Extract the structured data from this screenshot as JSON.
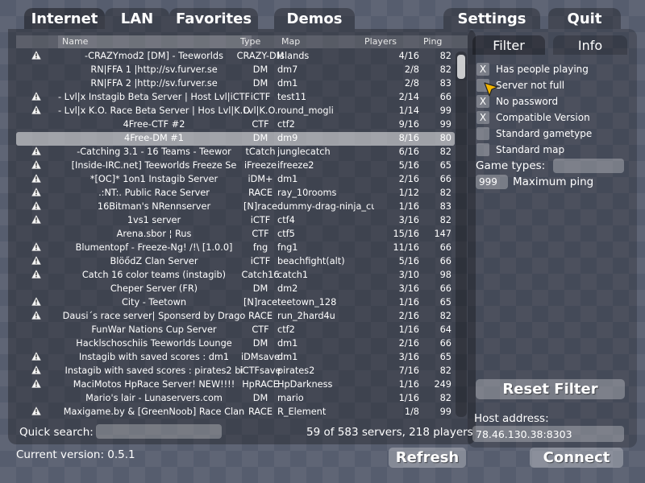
{
  "tabs": {
    "internet": "Internet",
    "lan": "LAN",
    "favorites": "Favorites",
    "demos": "Demos",
    "settings": "Settings",
    "quit": "Quit"
  },
  "header": {
    "name": "Name",
    "type": "Type",
    "map": "Map",
    "players": "Players",
    "ping": "Ping"
  },
  "servers": [
    {
      "icon": "warning-icon",
      "name": "-CRAZYmod2 [DM] - Teeworlds",
      "type": "CRAZY-DM",
      "map": "islands",
      "players": "4/16",
      "ping": "82"
    },
    {
      "icon": "",
      "name": "RN|FFA 1 |http://sv.furver.se",
      "type": "DM",
      "map": "dm7",
      "players": "2/8",
      "ping": "82"
    },
    {
      "icon": "",
      "name": "RN|FFA 2 |http://sv.furver.se",
      "type": "DM",
      "map": "dm1",
      "players": "2/8",
      "ping": "83"
    },
    {
      "icon": "warning-icon",
      "name": "- Lvl|x Instagib Beta Server | Host Lvl|iCTF",
      "type": "iCTF",
      "map": "test11",
      "players": "2/14",
      "ping": "66"
    },
    {
      "icon": "warning-icon",
      "name": "- Lvl|x K.O. Race Beta Server | Hos Lvl|K.O.",
      "type": "Lvl|K.O.",
      "map": "round_mogli",
      "players": "1/14",
      "ping": "99"
    },
    {
      "icon": "",
      "name": "4Free-CTF #2",
      "type": "CTF",
      "map": "ctf2",
      "players": "9/16",
      "ping": "99"
    },
    {
      "icon": "",
      "name": "4Free-DM #1",
      "type": "DM",
      "map": "dm9",
      "players": "8/16",
      "ping": "80",
      "selected": true
    },
    {
      "icon": "warning-icon",
      "name": "-Catching 3.1 - 16 Teams - Teewor",
      "type": "tCatch",
      "map": "junglecatch",
      "players": "6/16",
      "ping": "82"
    },
    {
      "icon": "warning-icon",
      "name": "[Inside-IRC.net] Teeworlds Freeze Se",
      "type": "iFreeze",
      "map": "ifreeze2",
      "players": "5/16",
      "ping": "65"
    },
    {
      "icon": "warning-icon",
      "name": "*[OC]* 1on1 Instagib Server",
      "type": "iDM+",
      "map": "dm1",
      "players": "2/16",
      "ping": "66"
    },
    {
      "icon": "warning-icon",
      "name": ".:NT:. Public Race Server",
      "type": "RACE",
      "map": "ray_10rooms",
      "players": "1/12",
      "ping": "82"
    },
    {
      "icon": "warning-icon",
      "name": "16Bitman's NRennserver",
      "type": "[N]race",
      "map": "dummy-drag-ninja_custom",
      "players": "1/16",
      "ping": "83"
    },
    {
      "icon": "warning-icon",
      "name": "1vs1 server",
      "type": "iCTF",
      "map": "ctf4",
      "players": "3/16",
      "ping": "82"
    },
    {
      "icon": "",
      "name": "Arena.sbor ¦ Rus",
      "type": "CTF",
      "map": "ctf5",
      "players": "15/16",
      "ping": "147"
    },
    {
      "icon": "warning-icon",
      "name": "Blumentopf - Freeze-Ng! /!\\ [1.0.0]",
      "type": "fng",
      "map": "fng1",
      "players": "11/16",
      "ping": "66"
    },
    {
      "icon": "warning-icon",
      "name": "BlöődZ Clan Server",
      "type": "iCTF",
      "map": "beachfight(alt)",
      "players": "5/16",
      "ping": "66"
    },
    {
      "icon": "warning-icon",
      "name": "Catch 16 color teams (instagib)",
      "type": "Catch16",
      "map": "catch1",
      "players": "3/10",
      "ping": "98"
    },
    {
      "icon": "",
      "name": "Cheper Server (FR)",
      "type": "DM",
      "map": "dm2",
      "players": "3/16",
      "ping": "66"
    },
    {
      "icon": "warning-icon",
      "name": "City - Teetown",
      "type": "[N]race",
      "map": "teetown_128",
      "players": "1/16",
      "ping": "65"
    },
    {
      "icon": "warning-icon",
      "name": "Dausi´s race server| Sponserd by Drago",
      "type": "RACE",
      "map": "run_2hard4u",
      "players": "2/16",
      "ping": "82"
    },
    {
      "icon": "",
      "name": "FunWar Nations Cup Server",
      "type": "CTF",
      "map": "ctf2",
      "players": "1/16",
      "ping": "64"
    },
    {
      "icon": "",
      "name": "Hacklschoschiis Teeworlds Lounge",
      "type": "DM",
      "map": "dm1",
      "players": "2/16",
      "ping": "66"
    },
    {
      "icon": "warning-icon",
      "name": "Instagib with saved scores : dm1",
      "type": "iDMsave",
      "map": "dm1",
      "players": "3/16",
      "ping": "65"
    },
    {
      "icon": "warning-icon",
      "name": "Instagib with saved scores : pirates2 bi",
      "type": "iCTFsave",
      "map": "pirates2",
      "players": "7/16",
      "ping": "82"
    },
    {
      "icon": "warning-icon",
      "name": "MaciMotos HpRace Server! NEW!!!!",
      "type": "HpRACE",
      "map": "HpDarkness",
      "players": "1/16",
      "ping": "249"
    },
    {
      "icon": "",
      "name": "Mario's lair - Lunaservers.com",
      "type": "DM",
      "map": "mario",
      "players": "1/16",
      "ping": "82"
    },
    {
      "icon": "warning-icon",
      "name": "Maxigame.by & [GreenNoob] Race Clan",
      "type": "RACE",
      "map": "R_Element",
      "players": "1/8",
      "ping": "99"
    }
  ],
  "quick_search": {
    "label": "Quick search:",
    "value": ""
  },
  "server_count": "59 of 583 servers, 218 players",
  "current_version": "Current version: 0.5.1",
  "buttons": {
    "refresh": "Refresh",
    "connect": "Connect",
    "reset_filter": "Reset Filter"
  },
  "right_tabs": {
    "filter": "Filter",
    "info": "Info"
  },
  "filters": [
    {
      "label": "Has people playing",
      "checked": "X"
    },
    {
      "label": "Server not full",
      "checked": ""
    },
    {
      "label": "No password",
      "checked": "X"
    },
    {
      "label": "Compatible Version",
      "checked": "X"
    },
    {
      "label": "Standard gametype",
      "checked": ""
    },
    {
      "label": "Standard map",
      "checked": ""
    }
  ],
  "game_types": {
    "label": "Game types:",
    "value": ""
  },
  "max_ping": {
    "value": "999",
    "label": "Maximum ping"
  },
  "host": {
    "label": "Host address:",
    "value": "78.46.130.38:8303"
  },
  "colors": {
    "background": "#565d6e",
    "selection": "#b8b8b8",
    "cursor": "#f2b400"
  }
}
